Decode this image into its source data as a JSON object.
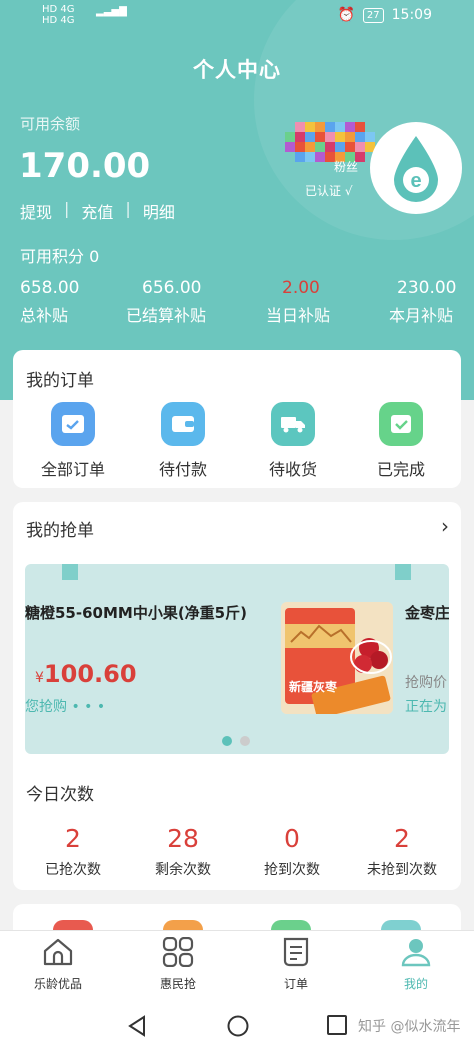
{
  "status_bar": {
    "signal_left_top": "HD 4G",
    "signal_left_bottom": "HD 4G",
    "battery": "27",
    "time": "15:09"
  },
  "header": {
    "title": "个人中心",
    "balance_label": "可用余额",
    "balance": "170.00",
    "links": [
      "提现",
      "充值",
      "明细"
    ],
    "link_separator": "|",
    "fans_label": "粉丝",
    "verified_label": "已认证 √",
    "points": "可用积分 0",
    "stats": [
      {
        "value": "658.00",
        "label": "总补贴",
        "color": "#ffffff"
      },
      {
        "value": "656.00",
        "label": "已结算补贴",
        "color": "#ffffff"
      },
      {
        "value": "2.00",
        "label": "当日补贴",
        "color": "#d9403a"
      },
      {
        "value": "230.00",
        "label": "本月补贴",
        "color": "#ffffff"
      }
    ]
  },
  "orders": {
    "title": "我的订单",
    "items": [
      {
        "label": "全部订单",
        "icon": "list-icon",
        "color": "#5aa4ee"
      },
      {
        "label": "待付款",
        "icon": "wallet-icon",
        "color": "#5bb8ec"
      },
      {
        "label": "待收货",
        "icon": "truck-icon",
        "color": "#5cc6bf"
      },
      {
        "label": "已完成",
        "icon": "check-icon",
        "color": "#66d38a"
      }
    ]
  },
  "grab": {
    "title": "我的抢单",
    "more_icon": "chevron-right-icon",
    "product_name": "糖橙55-60MM中小果(净重5斤)",
    "price_symbol": "¥",
    "price": "100.60",
    "grab_hint": "您抢购 • • •",
    "image_caption": "新疆灰枣",
    "next_product_name": "金枣庄",
    "next_line1": "抢购价",
    "next_line2": "正在为",
    "carousel_active": 0,
    "today_title": "今日次数",
    "counts": [
      {
        "value": "2",
        "label": "已抢次数"
      },
      {
        "value": "28",
        "label": "剩余次数"
      },
      {
        "value": "0",
        "label": "抢到次数"
      },
      {
        "value": "2",
        "label": "未抢到次数"
      }
    ]
  },
  "tabbar": {
    "items": [
      {
        "label": "乐龄优品",
        "icon": "home-icon"
      },
      {
        "label": "惠民抢",
        "icon": "grid-icon"
      },
      {
        "label": "订单",
        "icon": "document-icon"
      },
      {
        "label": "我的",
        "icon": "profile-icon"
      }
    ],
    "active": 3,
    "accent": "#4db8b0"
  },
  "navbar": {
    "watermark": "知乎 @似水流年"
  }
}
